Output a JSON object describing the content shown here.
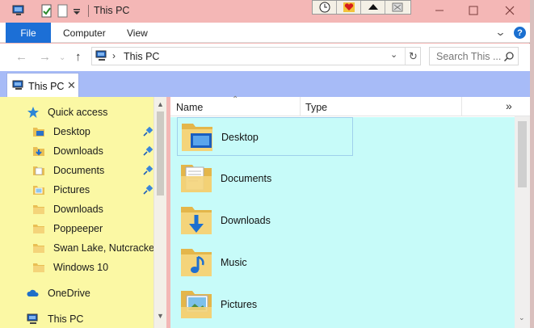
{
  "window": {
    "title": "This PC"
  },
  "ribbon": {
    "file_label": "File",
    "tabs": [
      "Computer",
      "View"
    ]
  },
  "address": {
    "location": "This PC"
  },
  "search": {
    "placeholder": "Search This ..."
  },
  "tab": {
    "label": "This PC"
  },
  "sidebar": {
    "items": [
      {
        "label": "Quick access",
        "icon": "star-icon",
        "pinned": false
      },
      {
        "label": "Desktop",
        "icon": "desktop-folder-icon",
        "pinned": true
      },
      {
        "label": "Downloads",
        "icon": "downloads-folder-icon",
        "pinned": true
      },
      {
        "label": "Documents",
        "icon": "documents-folder-icon",
        "pinned": true
      },
      {
        "label": "Pictures",
        "icon": "pictures-folder-icon",
        "pinned": true
      },
      {
        "label": "Downloads",
        "icon": "folder-icon",
        "pinned": false
      },
      {
        "label": "Poppeeper",
        "icon": "folder-icon",
        "pinned": false
      },
      {
        "label": "Swan Lake, Nutcracker, (",
        "icon": "folder-icon",
        "pinned": false
      },
      {
        "label": "Windows 10",
        "icon": "folder-icon",
        "pinned": false
      },
      {
        "label": "OneDrive",
        "icon": "cloud-icon",
        "pinned": false
      },
      {
        "label": "This PC",
        "icon": "computer-icon",
        "pinned": false
      }
    ]
  },
  "columns": {
    "name": "Name",
    "type": "Type"
  },
  "files": [
    {
      "label": "Desktop",
      "icon": "desktop-folder-icon"
    },
    {
      "label": "Documents",
      "icon": "documents-folder-icon"
    },
    {
      "label": "Downloads",
      "icon": "downloads-folder-icon"
    },
    {
      "label": "Music",
      "icon": "music-folder-icon"
    },
    {
      "label": "Pictures",
      "icon": "pictures-folder-icon"
    }
  ],
  "colors": {
    "titlebar": "#f4b7b6",
    "accent": "#1c6fd6",
    "sidebar_bg": "#fbf8a4",
    "content_bg": "#c7fbf9",
    "tabstrip_bg": "#a7bbf7"
  }
}
